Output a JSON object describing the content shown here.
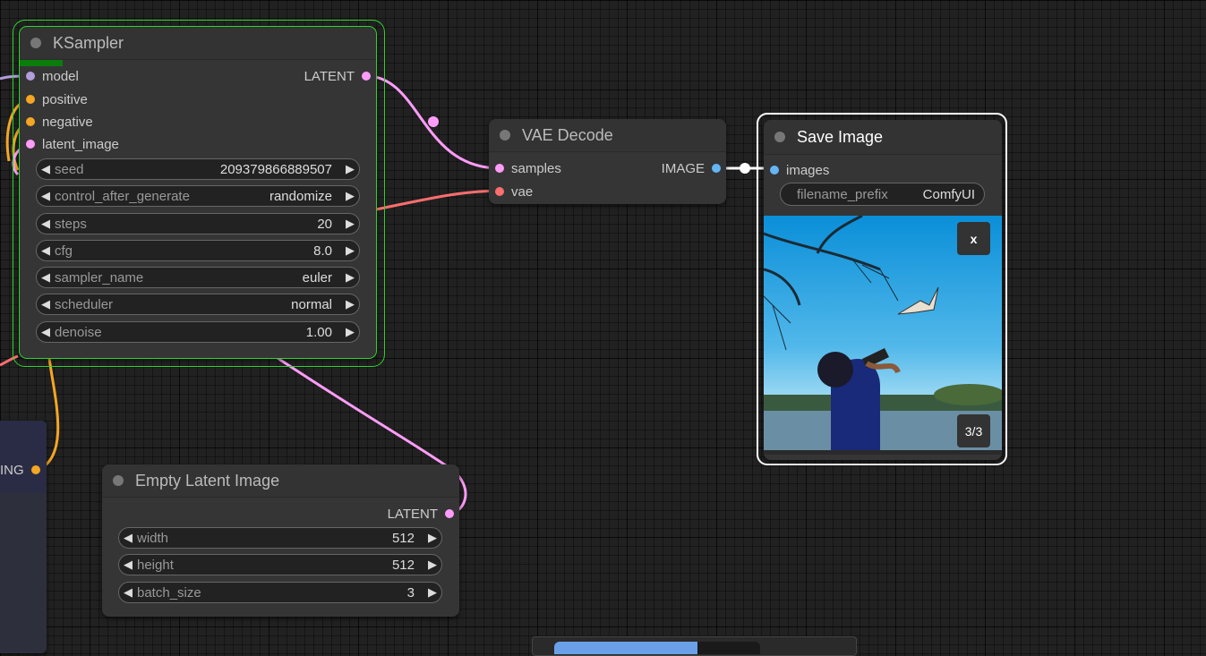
{
  "colors": {
    "model": "#b39ddb",
    "positive": "#f5a623",
    "negative": "#f5a623",
    "latent": "#ff9cf9",
    "image": "#64b5f6",
    "vae": "#ff6e6e",
    "conditioning": "#f5a623"
  },
  "ksampler": {
    "title": "KSampler",
    "inputs": [
      "model",
      "positive",
      "negative",
      "latent_image"
    ],
    "output": "LATENT",
    "widgets": [
      {
        "label": "seed",
        "value": "209379866889507"
      },
      {
        "label": "control_after_generate",
        "value": "randomize"
      },
      {
        "label": "steps",
        "value": "20"
      },
      {
        "label": "cfg",
        "value": "8.0"
      },
      {
        "label": "sampler_name",
        "value": "euler"
      },
      {
        "label": "scheduler",
        "value": "normal"
      },
      {
        "label": "denoise",
        "value": "1.00"
      }
    ],
    "progress": 0.12
  },
  "vae_decode": {
    "title": "VAE Decode",
    "inputs": [
      "samples",
      "vae"
    ],
    "output": "IMAGE"
  },
  "save_image": {
    "title": "Save Image",
    "input": "images",
    "widget": {
      "label": "filename_prefix",
      "value": "ComfyUI"
    },
    "close_label": "x",
    "counter": "3/3"
  },
  "empty_latent": {
    "title": "Empty Latent Image",
    "output": "LATENT",
    "widgets": [
      {
        "label": "width",
        "value": "512"
      },
      {
        "label": "height",
        "value": "512"
      },
      {
        "label": "batch_size",
        "value": "3"
      }
    ]
  },
  "partial_node": {
    "output": "ING"
  }
}
